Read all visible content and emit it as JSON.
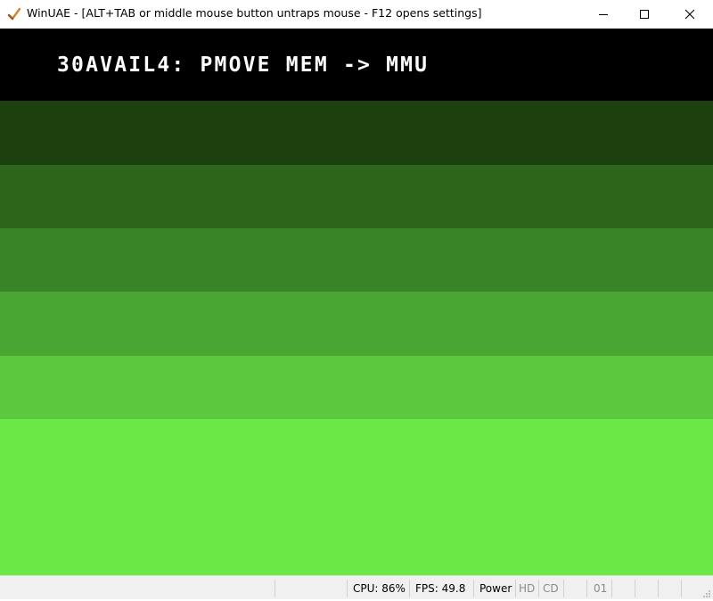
{
  "window": {
    "title": "WinUAE - [ALT+TAB or middle mouse button untraps mouse - F12 opens settings]",
    "icons": {
      "app": "winuae-checkmark-icon",
      "minimize": "minimize-icon",
      "maximize": "maximize-icon",
      "close": "close-icon"
    }
  },
  "screen": {
    "message": "30AVAIL4: PMOVE MEM -> MMU",
    "bands": [
      "#000000",
      "#1c400e",
      "#2b661b",
      "#3a8428",
      "#4aa632",
      "#5bc83e",
      "#6be845"
    ]
  },
  "status": {
    "cpu": "CPU: 86%",
    "fps": "FPS: 49.8",
    "power": "Power",
    "hd": "HD",
    "cd": "CD",
    "drive": "01"
  }
}
